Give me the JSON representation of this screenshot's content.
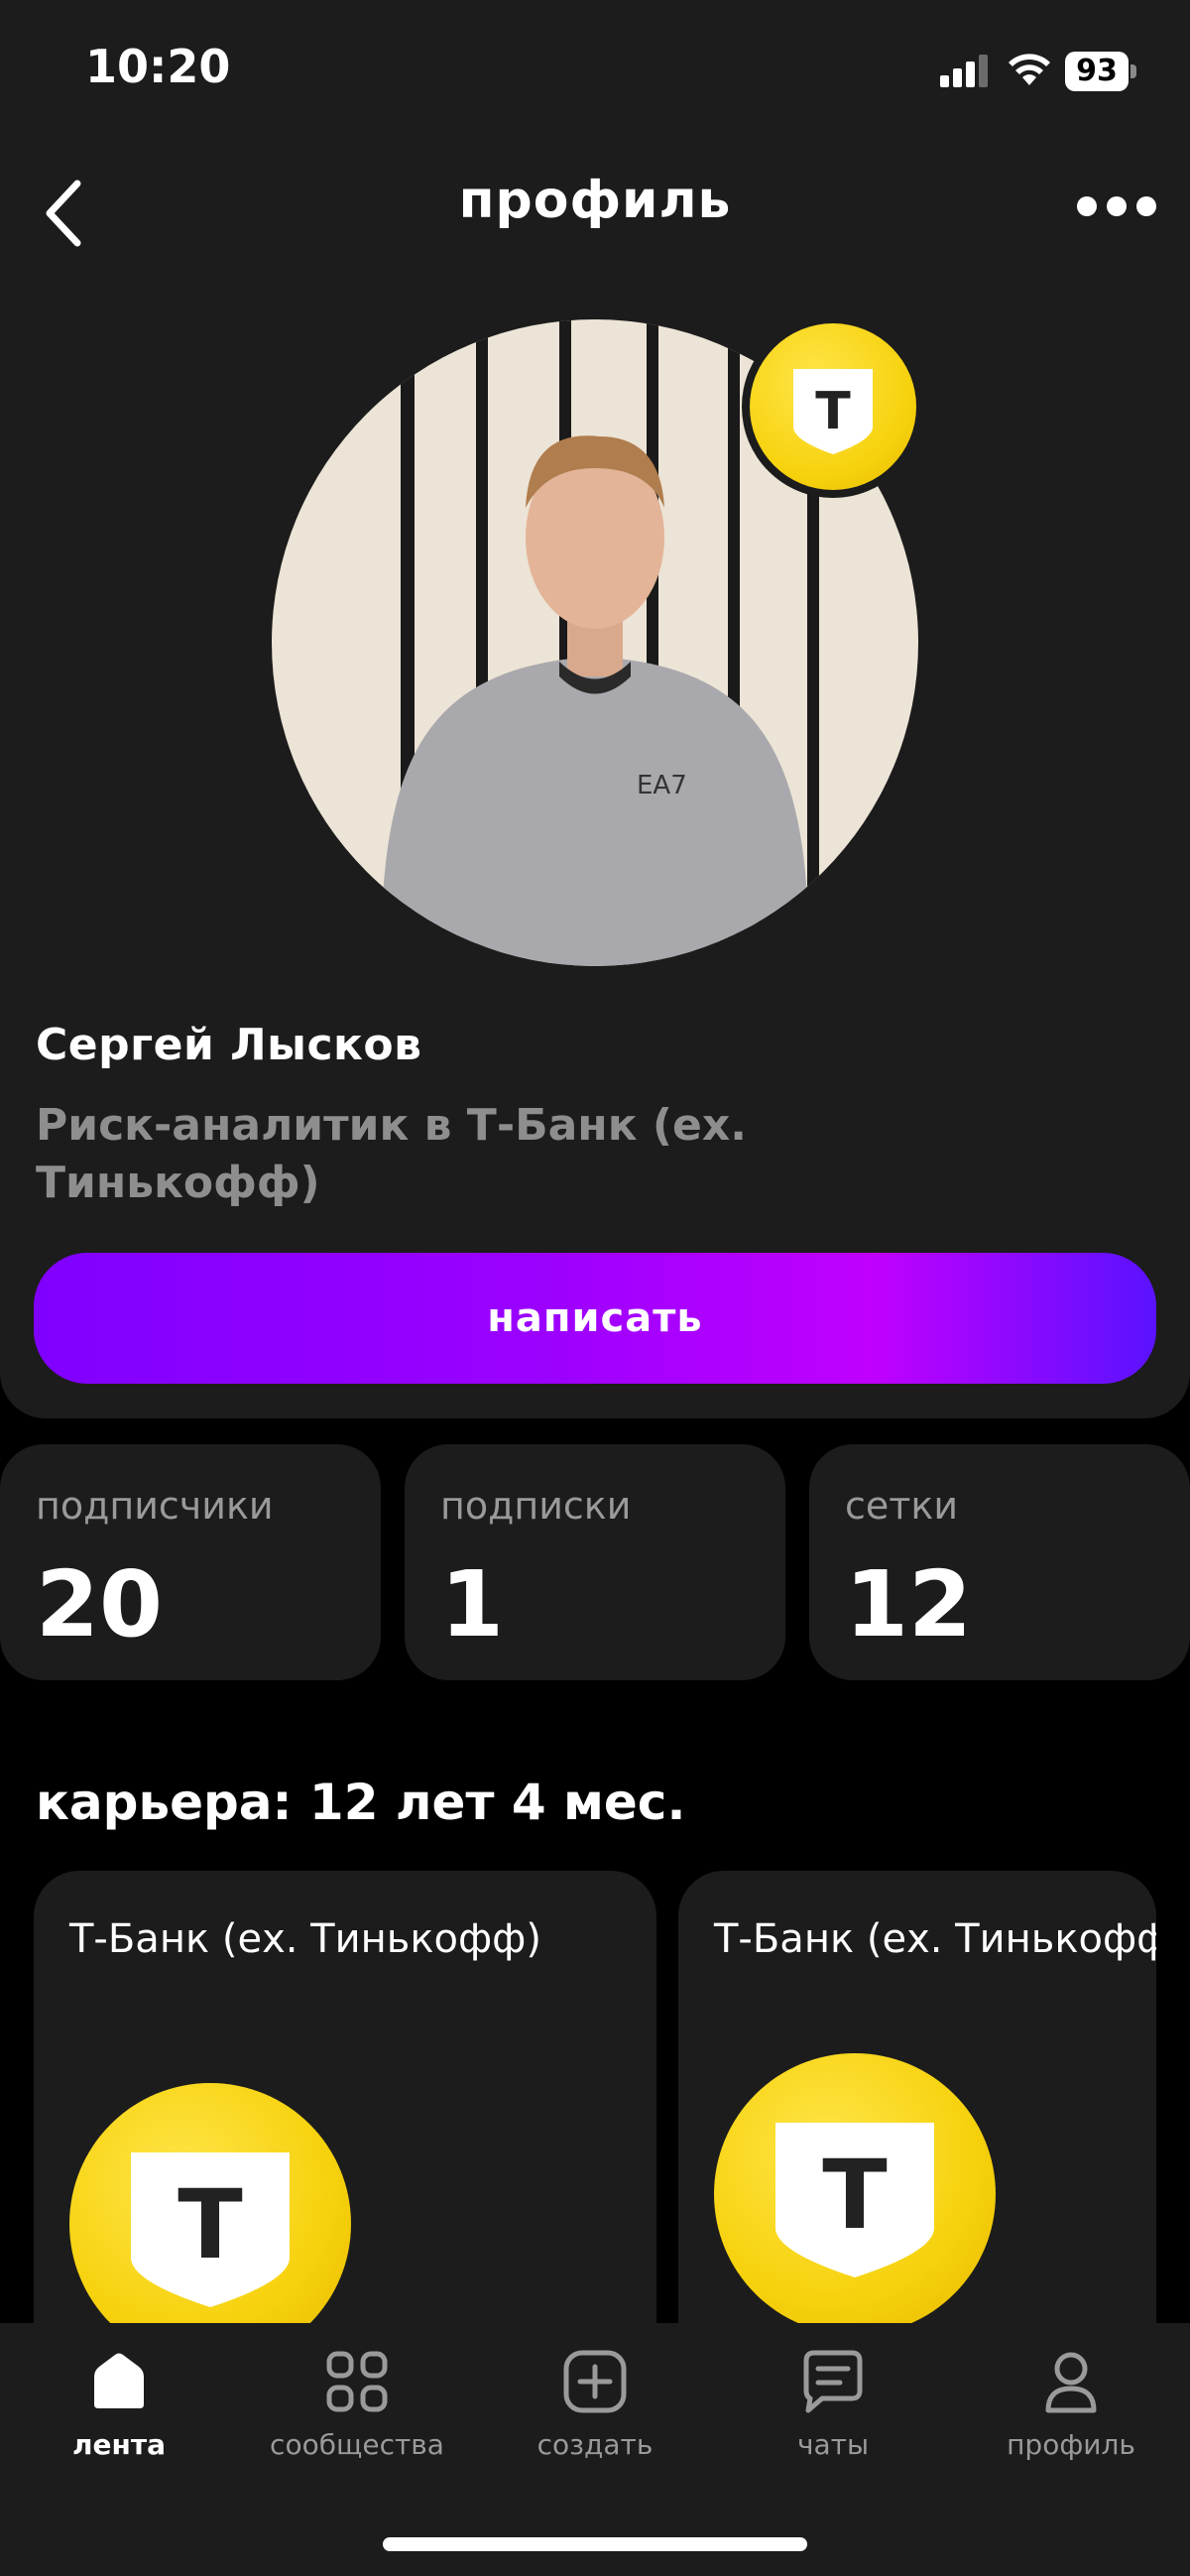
{
  "status_bar": {
    "time": "10:20",
    "battery": "93"
  },
  "header": {
    "title": "профиль"
  },
  "user": {
    "name": "Сергей Лысков",
    "role": "Риск-аналитик в Т-Банк (ех. Тинькофф)",
    "write_label": "написать"
  },
  "stats": [
    {
      "label": "подписчики",
      "value": "20"
    },
    {
      "label": "подписки",
      "value": "1"
    },
    {
      "label": "сетки",
      "value": "12"
    }
  ],
  "career": {
    "title": "карьера: 12 лет 4 мес.",
    "items": [
      {
        "company": "Т-Банк (ех. Тинькофф)",
        "logo_letter": "Т"
      },
      {
        "company": "Т-Банк (ех. Тинькофф)",
        "logo_letter": "Т"
      }
    ]
  },
  "badge_letter": "Т",
  "tabs": [
    {
      "label": "лента",
      "icon": "home-icon",
      "active": true
    },
    {
      "label": "сообщества",
      "icon": "grid-icon",
      "active": false
    },
    {
      "label": "создать",
      "icon": "plus-square-icon",
      "active": false
    },
    {
      "label": "чаты",
      "icon": "chat-icon",
      "active": false
    },
    {
      "label": "профиль",
      "icon": "person-icon",
      "active": false
    }
  ],
  "colors": {
    "accent_start": "#8000ff",
    "accent_end": "#5a12ff",
    "brand_yellow": "#f6d10c",
    "card": "#1c1c1c"
  }
}
